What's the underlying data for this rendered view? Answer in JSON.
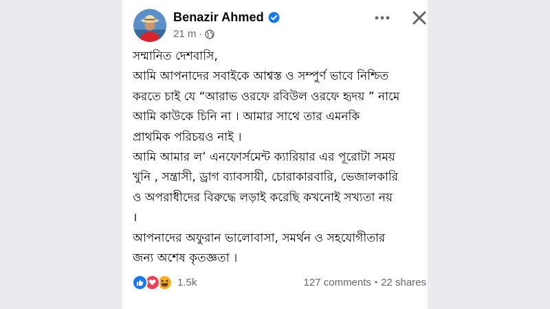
{
  "post": {
    "author": "Benazir Ahmed",
    "time": "21 m",
    "meta_separator": "·",
    "lines": [
      "সম্মানিত দেশবাসি,",
      "আমি আপনাদের সবাইকে আশ্বস্ত ও সম্পুর্ণ ভাবে নিশ্চিত",
      "করতে চাই যে “আরাভ ওরফে রবিউল ওরফে হৃদয় ” নামে",
      "আমি কাউকে চিনি না । আমার সাথে তার এমনকি",
      "প্রাথমিক পরিচয়ও নাই ।",
      "আমি আমার ল’ এনফোর্সমেন্ট ক্যারিয়ার এর পূরোটা সময়",
      "খুনি , সন্ত্রাসী, ড্রাগ ব্যাবসায়ী, চোরাকারবারি, ভেজালকারি",
      "ও অপরাধীদের বিরুদ্ধে লড়াই করেছি কখনোই সখ্যতা নয়",
      "।",
      "আপনাদের অফুরান ভালোবাসা, সমর্থন ও সহযোগীতার",
      "জন্য অশেষ কৃতজ্ঞতা ।"
    ],
    "reactions_count": "1.5k",
    "comments": "127 comments",
    "stats_separator": "•",
    "shares": "22 shares",
    "icons": {
      "more": "more-dots-icon",
      "close": "close-icon",
      "verified": "verified-badge-icon",
      "audience": "globe-icon",
      "reactions": [
        "like-icon",
        "love-icon",
        "haha-icon"
      ]
    },
    "colors": {
      "brand_blue": "#1877f2",
      "love_red": "#f33e58",
      "haha_yellow": "#f7b125",
      "meta_gray": "#65676b"
    }
  }
}
